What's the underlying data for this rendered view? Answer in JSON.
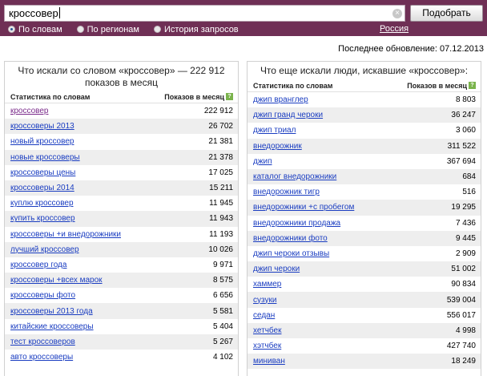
{
  "search": {
    "value": "кроссовер",
    "button_label": "Подобрать"
  },
  "modes": [
    {
      "label": "По словам",
      "selected": true
    },
    {
      "label": "По регионам",
      "selected": false
    },
    {
      "label": "История запросов",
      "selected": false
    }
  ],
  "region": "Россия",
  "updated": "Последнее обновление: 07.12.2013",
  "left": {
    "title": "Что искали со словом «кроссовер» — 222 912 показов в месяц",
    "col_keyword": "Статистика по словам",
    "col_count": "Показов в месяц",
    "rows": [
      {
        "kw": "кроссовер",
        "count": "222 912"
      },
      {
        "kw": "кроссоверы 2013",
        "count": "26 702"
      },
      {
        "kw": "новый кроссовер",
        "count": "21 381"
      },
      {
        "kw": "новые кроссоверы",
        "count": "21 378"
      },
      {
        "kw": "кроссоверы цены",
        "count": "17 025"
      },
      {
        "kw": "кроссоверы 2014",
        "count": "15 211"
      },
      {
        "kw": "куплю кроссовер",
        "count": "11 945"
      },
      {
        "kw": "купить кроссовер",
        "count": "11 943"
      },
      {
        "kw": "кроссоверы +и внедорожники",
        "count": "11 193"
      },
      {
        "kw": "лучший кроссовер",
        "count": "10 026"
      },
      {
        "kw": "кроссовер года",
        "count": "9 971"
      },
      {
        "kw": "кроссоверы +всех марок",
        "count": "8 575"
      },
      {
        "kw": "кроссоверы фото",
        "count": "6 656"
      },
      {
        "kw": "кроссоверы 2013 года",
        "count": "5 581"
      },
      {
        "kw": "китайские кроссоверы",
        "count": "5 404"
      },
      {
        "kw": "тест кроссоверов",
        "count": "5 267"
      },
      {
        "kw": "авто кроссоверы",
        "count": "4 102"
      }
    ]
  },
  "right": {
    "title": "Что еще искали люди, искавшие «кроссовер»:",
    "col_keyword": "Статистика по словам",
    "col_count": "Показов в месяц",
    "rows": [
      {
        "kw": "джип вранглер",
        "count": "8 803"
      },
      {
        "kw": "джип гранд чероки",
        "count": "36 247"
      },
      {
        "kw": "джип триал",
        "count": "3 060"
      },
      {
        "kw": "внедорожник",
        "count": "311 522"
      },
      {
        "kw": "джип",
        "count": "367 694"
      },
      {
        "kw": "каталог внедорожники",
        "count": "684"
      },
      {
        "kw": "внедорожник тигр",
        "count": "516"
      },
      {
        "kw": "внедорожники +с пробегом",
        "count": "19 295"
      },
      {
        "kw": "внедорожники продажа",
        "count": "7 436"
      },
      {
        "kw": "внедорожники фото",
        "count": "9 445"
      },
      {
        "kw": "джип чероки отзывы",
        "count": "2 909"
      },
      {
        "kw": "джип чероки",
        "count": "51 002"
      },
      {
        "kw": "хаммер",
        "count": "90 834"
      },
      {
        "kw": "сузуки",
        "count": "539 004"
      },
      {
        "kw": "седан",
        "count": "556 017"
      },
      {
        "kw": "хетчбек",
        "count": "4 998"
      },
      {
        "kw": "хэтчбек",
        "count": "427 740"
      },
      {
        "kw": "миниван",
        "count": "18 249"
      }
    ]
  }
}
